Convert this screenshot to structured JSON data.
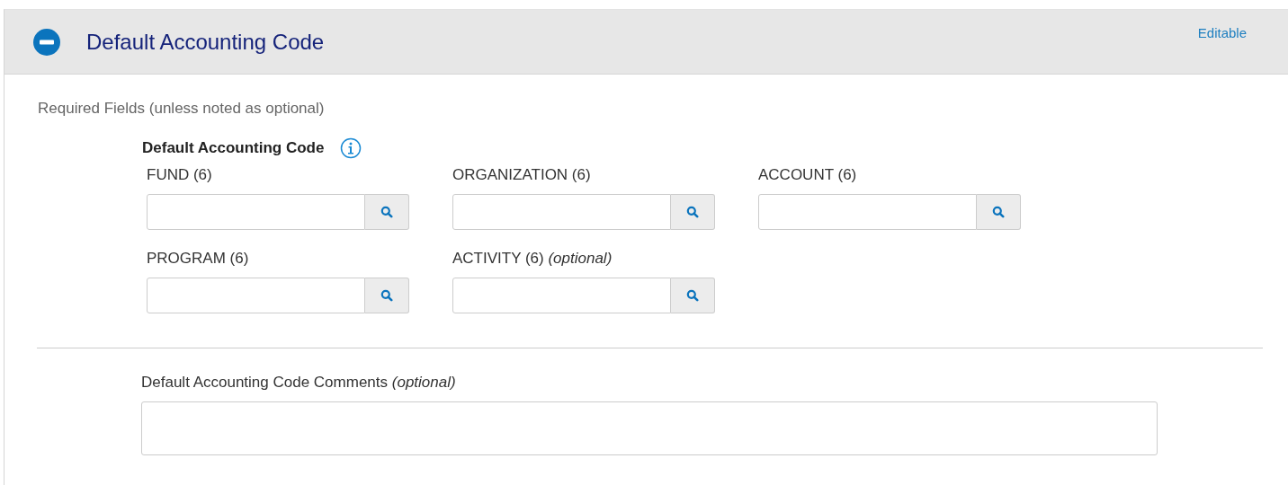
{
  "section": {
    "title": "Default Accounting Code",
    "expanded": true,
    "status": "Editable"
  },
  "note": "Required Fields (unless noted as optional)",
  "group": {
    "title": "Default Accounting Code",
    "fields": [
      {
        "label": "FUND (6)"
      },
      {
        "label": "ORGANIZATION (6)"
      },
      {
        "label": "ACCOUNT (6)"
      },
      {
        "label": "PROGRAM (6)"
      },
      {
        "label": "ACTIVITY (6) *(optional)*"
      }
    ]
  },
  "comments": {
    "label": "Default Accounting Code Comments *(optional)*"
  }
}
